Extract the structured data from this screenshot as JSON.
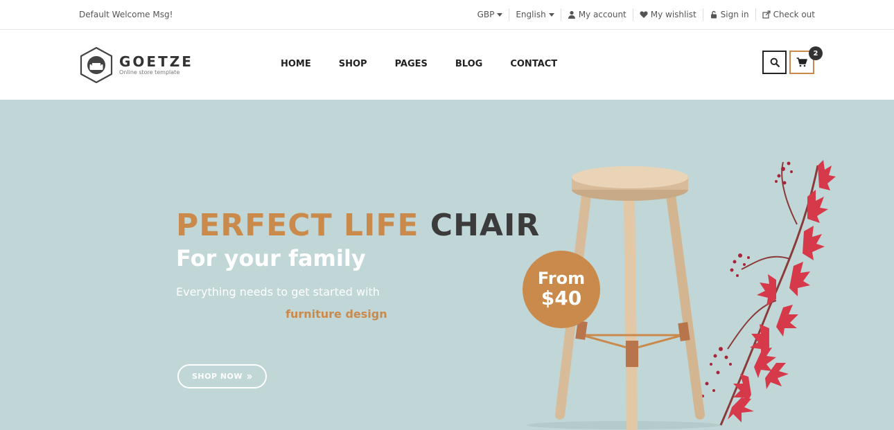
{
  "topbar": {
    "welcome": "Default Welcome Msg!",
    "currency": "GBP",
    "language": "English",
    "links": [
      {
        "label": "My account",
        "icon": "user-icon"
      },
      {
        "label": "My wishlist",
        "icon": "heart-icon"
      },
      {
        "label": "Sign in",
        "icon": "lock-icon"
      },
      {
        "label": "Check out",
        "icon": "checkout-icon"
      }
    ]
  },
  "header": {
    "logo_title": "GOETZE",
    "logo_subtitle": "Online store template",
    "nav": [
      "HOME",
      "SHOP",
      "PAGES",
      "BLOG",
      "CONTACT"
    ],
    "cart_count": "2"
  },
  "hero": {
    "title_accent": "PERFECT LIFE",
    "title_dark": "CHAIR",
    "subtitle": "For your family",
    "text_line1": "Everything needs to get started with",
    "text_line2": "furniture design",
    "cta_label": "SHOP NOW",
    "cta_icon": "double-chevron-right-icon",
    "price_from": "From",
    "price_value": "$40"
  },
  "colors": {
    "accent": "#c98a4c",
    "hero_bg": "#c1d6d6",
    "dark": "#3b3b3b"
  }
}
